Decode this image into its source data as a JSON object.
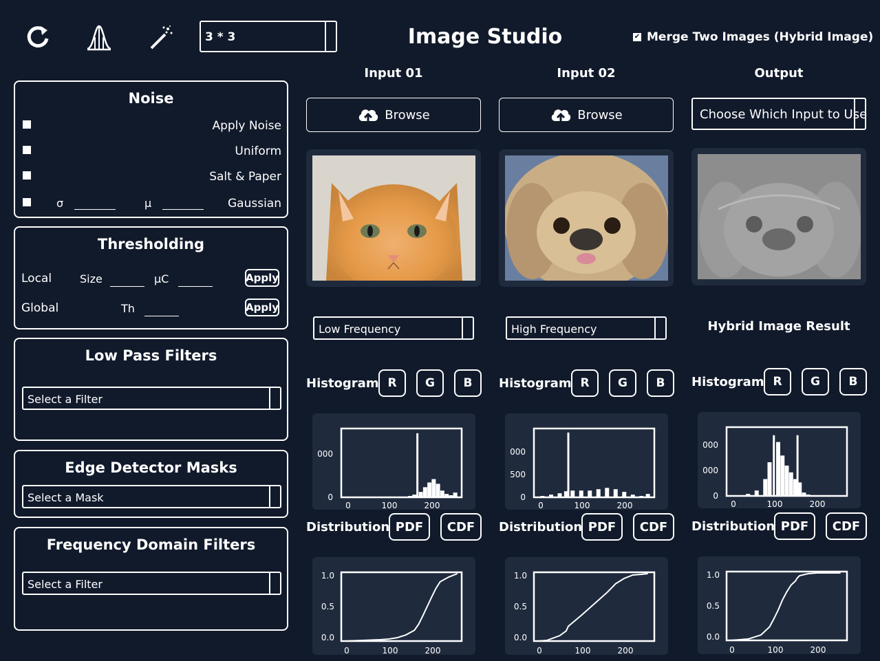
{
  "app": {
    "title": "Image Studio",
    "kernel_size": "3 * 3",
    "merge_label": "Merge Two Images (Hybrid Image)",
    "merge_checked": true
  },
  "toolbar": {
    "icons": [
      "refresh-icon",
      "histogram-curve-icon",
      "magic-wand-icon"
    ]
  },
  "noise": {
    "title": "Noise",
    "apply_noise": "Apply Noise",
    "uniform": "Uniform",
    "salt_pepper": "Salt & Paper",
    "gaussian": "Gaussian",
    "sigma_label": "σ",
    "mu_label": "μ"
  },
  "thresholding": {
    "title": "Thresholding",
    "local": "Local",
    "size_label": "Size",
    "uc_label": "μC",
    "global": "Global",
    "th_label": "Th",
    "apply": "Apply"
  },
  "low_pass": {
    "title": "Low Pass Filters",
    "select": "Select a Filter"
  },
  "edge": {
    "title": "Edge Detector Masks",
    "select": "Select a Mask"
  },
  "freq_domain": {
    "title": "Frequency Domain Filters",
    "select": "Select a Filter"
  },
  "columns": {
    "input1": {
      "header": "Input 01",
      "browse": "Browse",
      "freq_select": "Low Frequency",
      "histogram": "Histogram",
      "distribution": "Distribution",
      "hist_yticks": [
        "0",
        "000"
      ],
      "hist_xticks": [
        "0",
        "100",
        "200"
      ]
    },
    "input2": {
      "header": "Input 02",
      "browse": "Browse",
      "freq_select": "High Frequency",
      "histogram": "Histogram",
      "distribution": "Distribution",
      "hist_yticks": [
        "0",
        "500",
        "000"
      ],
      "hist_xticks": [
        "0",
        "100",
        "200"
      ]
    },
    "output": {
      "header": "Output",
      "choose": "Choose Which Input to Use",
      "hybrid_label": "Hybrid Image Result",
      "histogram": "Histogram",
      "distribution": "Distribution",
      "hist_yticks": [
        "0",
        "000",
        "000"
      ],
      "hist_xticks": [
        "0",
        "100",
        "200"
      ]
    }
  },
  "buttons": {
    "r": "R",
    "g": "G",
    "b": "B",
    "pdf": "PDF",
    "cdf": "CDF"
  },
  "cdf_axes": {
    "yticks": [
      "0.0",
      "0.5",
      "1.0"
    ],
    "xticks": [
      "0",
      "100",
      "200"
    ]
  },
  "colors": {
    "background": "#111a2b",
    "panel": "#1f2a3d",
    "foreground": "#ffffff"
  },
  "chart_data": [
    {
      "type": "area",
      "id": "hist1",
      "x": [
        0,
        20,
        40,
        60,
        80,
        100,
        120,
        140,
        150,
        160,
        167,
        175,
        185,
        195,
        205,
        215,
        225,
        235,
        245,
        255
      ],
      "y": [
        0,
        0,
        0,
        0,
        0,
        0,
        0,
        0,
        0.02,
        0.04,
        0.95,
        0.08,
        0.15,
        0.22,
        0.27,
        0.2,
        0.1,
        0.05,
        0.03,
        0.07
      ],
      "xlim": [
        -10,
        270
      ],
      "xticks": [
        0,
        100,
        200
      ]
    },
    {
      "type": "area",
      "id": "hist2",
      "x": [
        0,
        10,
        30,
        50,
        65,
        70,
        80,
        100,
        120,
        140,
        160,
        180,
        200,
        220,
        240,
        255
      ],
      "y": [
        0,
        0.02,
        0.04,
        0.06,
        0.09,
        0.96,
        0.1,
        0.1,
        0.1,
        0.12,
        0.14,
        0.12,
        0.08,
        0.04,
        0.02,
        0.05
      ],
      "xlim": [
        -10,
        270
      ],
      "xticks": [
        0,
        100,
        200
      ]
    },
    {
      "type": "area",
      "id": "hist3",
      "x": [
        0,
        20,
        40,
        60,
        80,
        90,
        100,
        110,
        120,
        130,
        140,
        150,
        155,
        160,
        170,
        180,
        200,
        220,
        240,
        255
      ],
      "y": [
        0,
        0.01,
        0.03,
        0.08,
        0.25,
        0.5,
        0.9,
        0.8,
        0.6,
        0.45,
        0.35,
        0.25,
        0.9,
        0.2,
        0.05,
        0.02,
        0.01,
        0,
        0,
        0
      ],
      "xlim": [
        -10,
        270
      ],
      "xticks": [
        0,
        100,
        200
      ]
    },
    {
      "type": "line",
      "id": "cdf1",
      "x": [
        0,
        40,
        80,
        100,
        120,
        140,
        160,
        170,
        180,
        200,
        210,
        220,
        240,
        260
      ],
      "y": [
        0,
        0.01,
        0.02,
        0.03,
        0.05,
        0.09,
        0.16,
        0.25,
        0.38,
        0.65,
        0.78,
        0.88,
        0.95,
        1.0
      ],
      "xlim": [
        -10,
        270
      ],
      "ylim": [
        0,
        1
      ],
      "yticks": [
        0,
        0.5,
        1
      ],
      "xticks": [
        0,
        100,
        200
      ]
    },
    {
      "type": "line",
      "id": "cdf2",
      "x": [
        0,
        20,
        50,
        65,
        70,
        100,
        130,
        160,
        180,
        200,
        220,
        240,
        255
      ],
      "y": [
        0,
        0.01,
        0.08,
        0.15,
        0.22,
        0.38,
        0.55,
        0.72,
        0.85,
        0.93,
        0.98,
        0.99,
        1.0
      ],
      "xlim": [
        -10,
        270
      ],
      "ylim": [
        0,
        1
      ],
      "yticks": [
        0,
        0.5,
        1
      ],
      "xticks": [
        0,
        100,
        200
      ]
    },
    {
      "type": "line",
      "id": "cdf3",
      "x": [
        0,
        40,
        70,
        90,
        100,
        110,
        120,
        130,
        140,
        150,
        155,
        160,
        180,
        200,
        240,
        255
      ],
      "y": [
        0,
        0.02,
        0.08,
        0.2,
        0.32,
        0.45,
        0.6,
        0.72,
        0.82,
        0.88,
        0.93,
        0.96,
        0.99,
        1.0,
        1.0,
        1.0
      ],
      "xlim": [
        -10,
        270
      ],
      "ylim": [
        0,
        1
      ],
      "yticks": [
        0,
        0.5,
        1
      ],
      "xticks": [
        0,
        100,
        200
      ]
    }
  ]
}
